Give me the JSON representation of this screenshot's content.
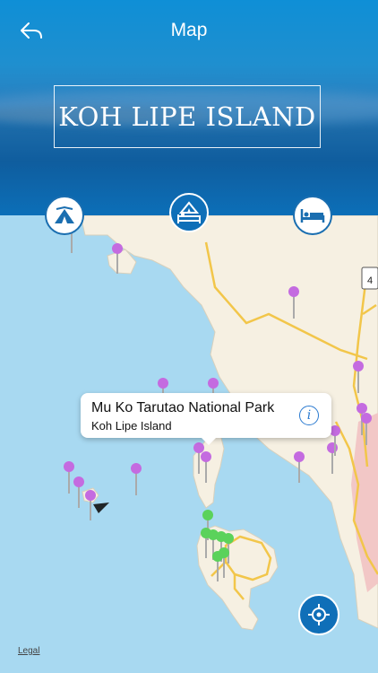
{
  "header": {
    "title": "Map",
    "banner_text": "KOH LIPE ISLAND",
    "back_icon": "back-arrow-icon"
  },
  "categories": [
    {
      "name": "camping",
      "icon": "tent-icon",
      "active": false
    },
    {
      "name": "resorts",
      "icon": "tent-bed-icon",
      "active": true
    },
    {
      "name": "hotels",
      "icon": "bed-icon",
      "active": false
    }
  ],
  "callout": {
    "title": "Mu Ko Tarutao National Park",
    "subtitle": "Koh Lipe Island",
    "info_icon": "i"
  },
  "map": {
    "road_badge": "4",
    "legal_label": "Legal",
    "pin_colors": {
      "purple": "#c46be0",
      "green": "#5bd25b"
    }
  },
  "locate_icon": "location-crosshair-icon"
}
